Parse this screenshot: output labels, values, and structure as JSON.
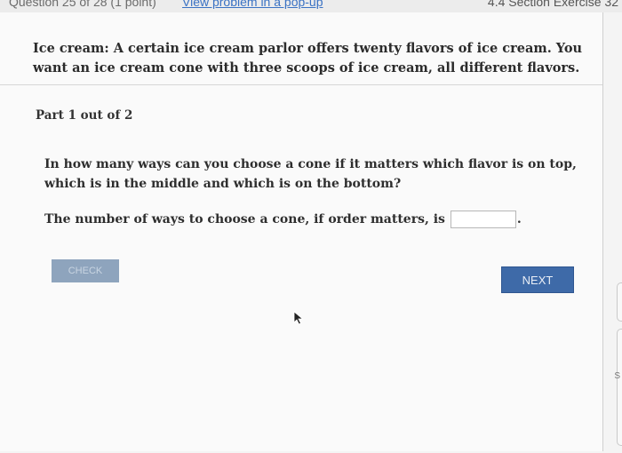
{
  "header": {
    "question_label": "Question 25 of 28 (1 point)",
    "popup_link": "View problem in a pop-up",
    "section": "4.4 Section Exercise 32"
  },
  "problem": {
    "intro_label": "Ice cream:",
    "intro_text": "A certain ice cream parlor offers twenty flavors of ice cream. You want an ice cream cone with three scoops of ice cream, all different flavors.",
    "part_label": "Part 1 out of 2",
    "question": "In how many ways can you choose a cone if it matters which flavor is on top, which is in the middle and which is on the bottom?",
    "answer_prompt": "The number of ways to choose a cone, if order matters, is",
    "answer_value": "",
    "answer_suffix": "."
  },
  "buttons": {
    "check": "CHECK",
    "next": "NEXT"
  },
  "side": {
    "letter": "S"
  },
  "colors": {
    "check_bg": "#8ea4bd",
    "next_bg": "#3e6aa8",
    "link": "#3a72c4"
  }
}
